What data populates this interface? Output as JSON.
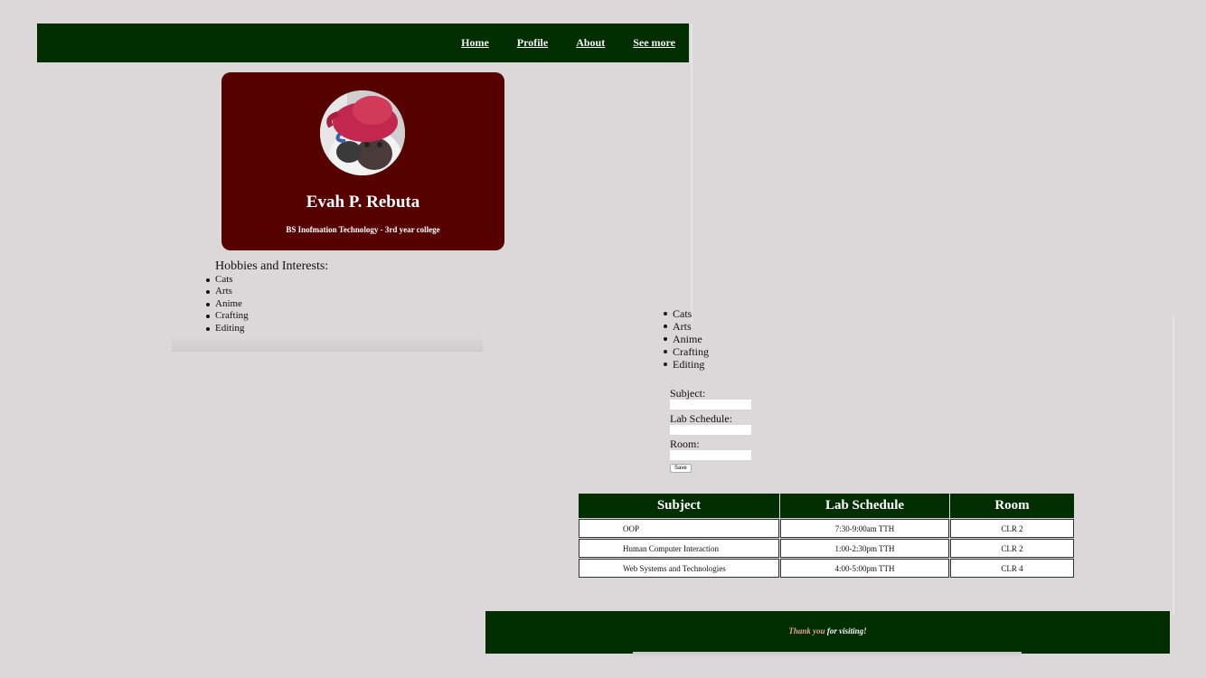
{
  "nav": {
    "items": [
      {
        "label": "Home"
      },
      {
        "label": "Profile"
      },
      {
        "label": "About"
      },
      {
        "label": "See more"
      }
    ]
  },
  "profile": {
    "name": "Evah P. Rebuta",
    "program": "BS Inofmation Technology - 3rd year college",
    "avatar": "cat-with-red-octopus-hat"
  },
  "hobbies": {
    "heading": "Hobbies and Interests:",
    "items": [
      "Cats",
      "Arts",
      "Anime",
      "Crafting",
      "Editing"
    ]
  },
  "form": {
    "subject_label": "Subject:",
    "lab_schedule_label": "Lab Schedule:",
    "room_label": "Room:",
    "subject_value": "",
    "lab_schedule_value": "",
    "room_value": "",
    "save_label": "Save"
  },
  "table": {
    "headers": [
      "Subject",
      "Lab Schedule",
      "Room"
    ],
    "rows": [
      [
        "OOP",
        "7:30-9:00am TTH",
        "CLR 2"
      ],
      [
        "Human Computer Interaction",
        "1:00-2:30pm TTH",
        "CLR 2"
      ],
      [
        "Web Systems and Technologies",
        "4:00-5:00pm TTH",
        "CLR 4"
      ]
    ]
  },
  "footer": {
    "accent": "Thank you",
    "rest": " for visiting!"
  },
  "colors": {
    "background": "#dcd7d8",
    "nav": "#002e00",
    "card": "#560000",
    "footer_accent": "#e8a0a0"
  }
}
